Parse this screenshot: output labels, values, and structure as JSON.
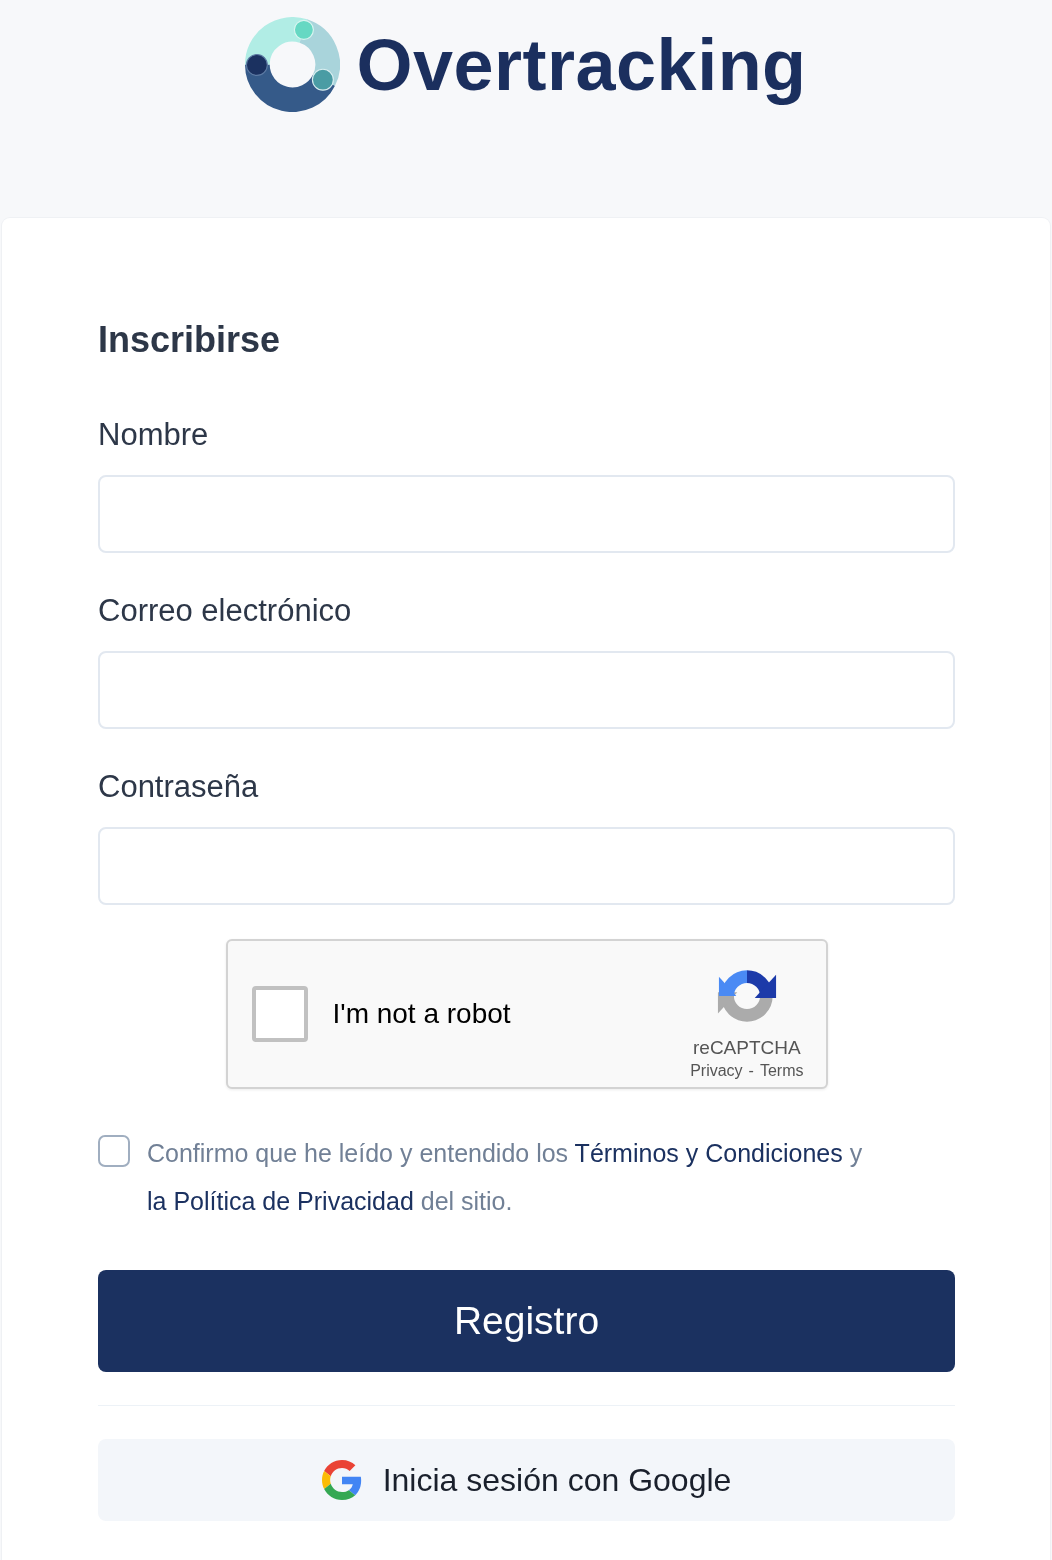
{
  "brand": {
    "name": "Overtracking"
  },
  "form": {
    "title": "Inscribirse",
    "fields": [
      {
        "label": "Nombre"
      },
      {
        "label": "Correo electrónico"
      },
      {
        "label": "Contraseña"
      }
    ]
  },
  "captcha": {
    "checked": false,
    "label": "I'm not a robot",
    "brand": "reCAPTCHA",
    "links": [
      "Privacy",
      "Terms"
    ],
    "separator": "-"
  },
  "consent": {
    "checked": false,
    "parts": [
      {
        "kind": "text",
        "text": "Confirmo que he leído y entendido los "
      },
      {
        "kind": "link",
        "text": "Términos y Condiciones"
      },
      {
        "kind": "text",
        "text": " y "
      },
      {
        "kind": "link",
        "text": "la Política de Privacidad"
      },
      {
        "kind": "text",
        "text": " del sitio."
      }
    ]
  },
  "submit": {
    "label": "Registro"
  },
  "google": {
    "label": "Inicia sesión con Google"
  }
}
